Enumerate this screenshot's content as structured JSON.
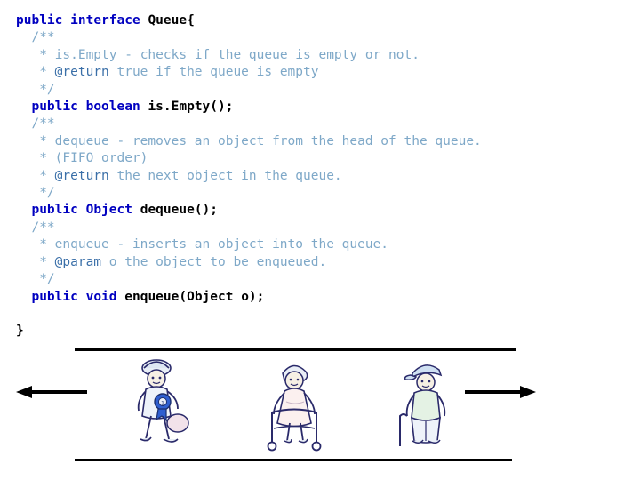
{
  "slide": {
    "code": {
      "lines": [
        [
          {
            "t": "public",
            "c": "kw"
          },
          {
            "t": " ",
            "c": "norm"
          },
          {
            "t": "interface",
            "c": "kw"
          },
          {
            "t": " ",
            "c": "norm"
          },
          {
            "t": "Queue{",
            "c": "plain"
          }
        ],
        [
          {
            "t": "  /**",
            "c": "cmt"
          }
        ],
        [
          {
            "t": "   * ",
            "c": "cmt"
          },
          {
            "t": "is.Empty",
            "c": "cmt"
          },
          {
            "t": " - checks if the queue is empty or not.",
            "c": "cmt"
          }
        ],
        [
          {
            "t": "   * ",
            "c": "cmt"
          },
          {
            "t": "@return",
            "c": "tag"
          },
          {
            "t": " true if the queue is empty",
            "c": "cmt"
          }
        ],
        [
          {
            "t": "   */",
            "c": "cmt"
          }
        ],
        [
          {
            "t": "  ",
            "c": "norm"
          },
          {
            "t": "public",
            "c": "kw"
          },
          {
            "t": " ",
            "c": "norm"
          },
          {
            "t": "boolean",
            "c": "kw"
          },
          {
            "t": " ",
            "c": "norm"
          },
          {
            "t": "is.Empty();",
            "c": "plain"
          }
        ],
        [
          {
            "t": "  /**",
            "c": "cmt"
          }
        ],
        [
          {
            "t": "   * dequeue - removes an object from the head of the queue.",
            "c": "cmt"
          }
        ],
        [
          {
            "t": "   * (FIFO order)",
            "c": "cmt"
          }
        ],
        [
          {
            "t": "   * ",
            "c": "cmt"
          },
          {
            "t": "@return",
            "c": "tag"
          },
          {
            "t": " the next object in the queue.",
            "c": "cmt"
          }
        ],
        [
          {
            "t": "   */",
            "c": "cmt"
          }
        ],
        [
          {
            "t": "  ",
            "c": "norm"
          },
          {
            "t": "public",
            "c": "kw"
          },
          {
            "t": " ",
            "c": "norm"
          },
          {
            "t": "Object",
            "c": "kw"
          },
          {
            "t": " ",
            "c": "norm"
          },
          {
            "t": "dequeue();",
            "c": "plain"
          }
        ],
        [
          {
            "t": "  /**",
            "c": "cmt"
          }
        ],
        [
          {
            "t": "   * enqueue - inserts an object into the queue.",
            "c": "cmt"
          }
        ],
        [
          {
            "t": "   * ",
            "c": "cmt"
          },
          {
            "t": "@param",
            "c": "tag"
          },
          {
            "t": " o the object to be enqueued.",
            "c": "cmt"
          }
        ],
        [
          {
            "t": "   */",
            "c": "cmt"
          }
        ],
        [
          {
            "t": "  ",
            "c": "norm"
          },
          {
            "t": "public",
            "c": "kw"
          },
          {
            "t": " ",
            "c": "norm"
          },
          {
            "t": "void",
            "c": "kw"
          },
          {
            "t": " ",
            "c": "norm"
          },
          {
            "t": "enqueue(Object o);",
            "c": "plain"
          }
        ],
        [
          {
            "t": "",
            "c": "norm"
          }
        ],
        [
          {
            "t": "}",
            "c": "plain"
          }
        ]
      ]
    },
    "diagram": {
      "rail_color": "#000000",
      "arrow_left_name": "dequeue-direction-arrow",
      "arrow_right_name": "enqueue-direction-arrow",
      "figures": [
        {
          "label": "person-with-ribbon-front-of-line"
        },
        {
          "label": "person-with-walker-middle-of-line"
        },
        {
          "label": "person-with-cane-end-of-line"
        }
      ]
    }
  }
}
